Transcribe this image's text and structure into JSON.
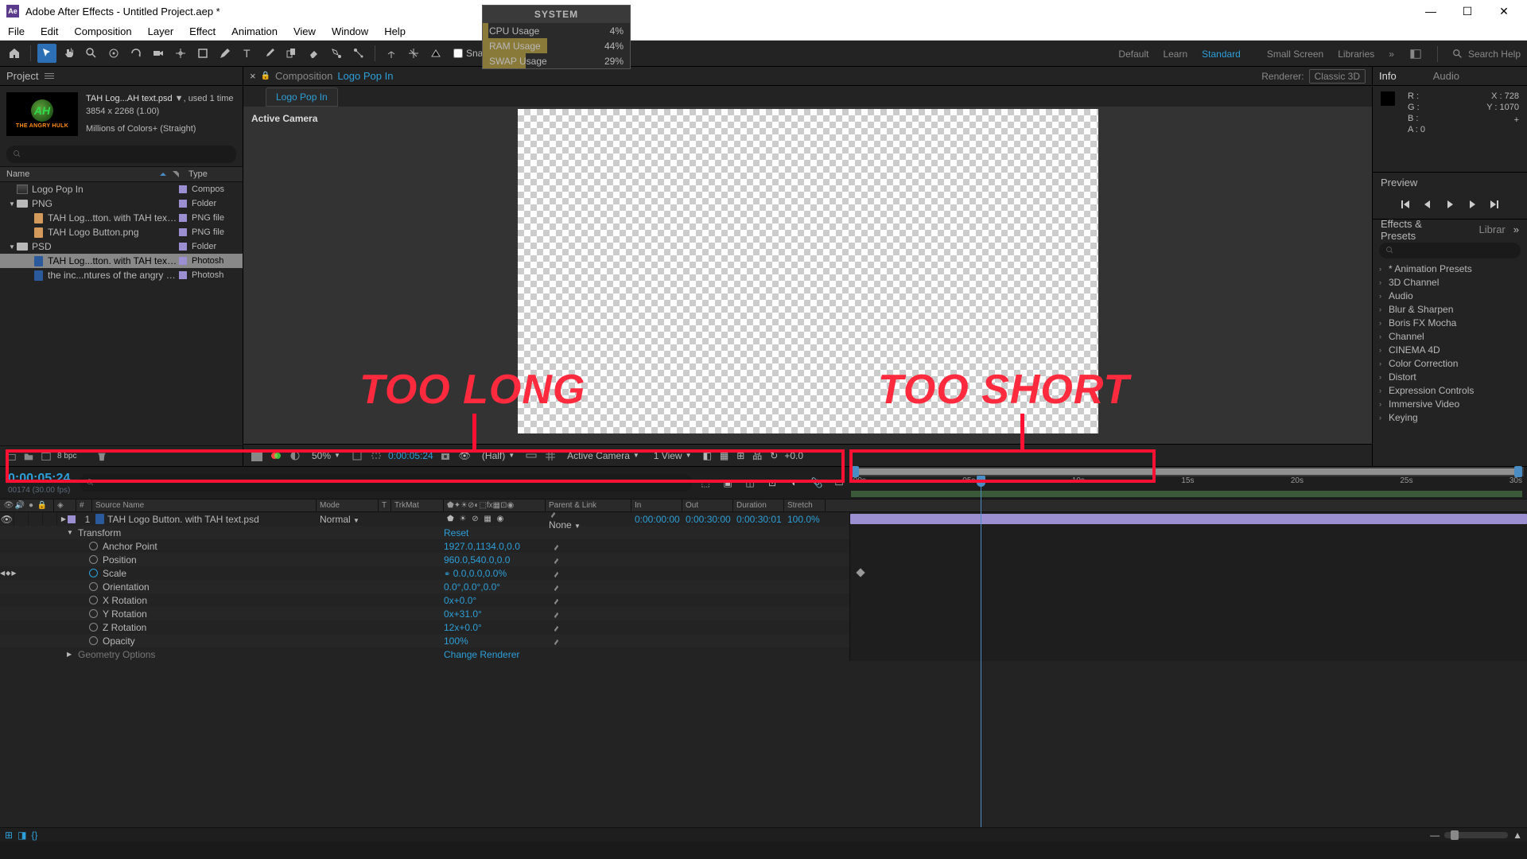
{
  "title": "Adobe After Effects - Untitled Project.aep *",
  "menus": [
    "File",
    "Edit",
    "Composition",
    "Layer",
    "Effect",
    "Animation",
    "View",
    "Window",
    "Help"
  ],
  "snapping": "Snapping",
  "workspaces": [
    "Default",
    "Learn",
    "Standard",
    "Small Screen",
    "Libraries"
  ],
  "workspace_active": "Standard",
  "search_help": "Search Help",
  "system": {
    "title": "SYSTEM",
    "rows": [
      {
        "label": "CPU Usage",
        "val": "4%",
        "pct": 4
      },
      {
        "label": "RAM Usage",
        "val": "44%",
        "pct": 44
      },
      {
        "label": "SWAP Usage",
        "val": "29%",
        "pct": 29
      }
    ]
  },
  "project": {
    "tab": "Project",
    "fname": "TAH Log...AH text.psd",
    "used": ", used 1 time",
    "dims": "3854 x 2268 (1.00)",
    "colors": "Millions of Colors+ (Straight)",
    "logo_sub": "THE ANGRY HULK",
    "hdrs": {
      "name": "Name",
      "type": "Type"
    },
    "bpc": "8 bpc",
    "tree": [
      {
        "ind": 10,
        "tw": "",
        "ico": "comp",
        "name": "Logo Pop In",
        "type": "Compos"
      },
      {
        "ind": 10,
        "tw": "▼",
        "ico": "folder",
        "name": "PNG",
        "type": "Folder"
      },
      {
        "ind": 30,
        "tw": "",
        "ico": "file",
        "name": "TAH Log...tton. with TAH text.png",
        "type": "PNG file"
      },
      {
        "ind": 30,
        "tw": "",
        "ico": "file",
        "name": "TAH Logo Button.png",
        "type": "PNG file"
      },
      {
        "ind": 10,
        "tw": "▼",
        "ico": "folder",
        "name": "PSD",
        "type": "Folder"
      },
      {
        "ind": 30,
        "tw": "",
        "ico": "psd",
        "name": "TAH Log...tton. with TAH text.psd",
        "type": "Photosh",
        "sel": true
      },
      {
        "ind": 30,
        "tw": "",
        "ico": "psd",
        "name": "the inc...ntures of the angry hulk.psd",
        "type": "Photosh"
      }
    ]
  },
  "comp": {
    "bc": "Composition",
    "name": "Logo Pop In",
    "tab": "Logo Pop In",
    "renderer_lbl": "Renderer:",
    "renderer": "Classic 3D",
    "active_cam": "Active Camera",
    "zoom": "50%",
    "time": "0:00:05:24",
    "res": "(Half)",
    "cam": "Active Camera",
    "views": "1 View",
    "exp": "+0.0"
  },
  "info": {
    "tab1": "Info",
    "tab2": "Audio",
    "R": "R :",
    "G": "G :",
    "B": "B :",
    "A": "A :  0",
    "X": "X : 728",
    "Y": "Y : 1070"
  },
  "preview": {
    "tab": "Preview"
  },
  "effects": {
    "tab1": "Effects & Presets",
    "tab2": "Librar",
    "list": [
      "* Animation Presets",
      "3D Channel",
      "Audio",
      "Blur & Sharpen",
      "Boris FX Mocha",
      "Channel",
      "CINEMA 4D",
      "Color Correction",
      "Distort",
      "Expression Controls",
      "Immersive Video",
      "Keying"
    ]
  },
  "timeline": {
    "time": "0:00:05:24",
    "sub": "00174 (30.00 fps)",
    "cols": {
      "av": "",
      "num": "#",
      "src": "Source Name",
      "mode": "Mode",
      "t": "T",
      "trk": "TrkMat",
      "sw": "",
      "parent": "Parent & Link",
      "in": "In",
      "out": "Out",
      "dur": "Duration",
      "str": "Stretch"
    },
    "ticks": [
      ":00s",
      "05s",
      "10s",
      "15s",
      "20s",
      "25s",
      "30s"
    ],
    "layer": {
      "num": "1",
      "name": "TAH Logo Button. with TAH text.psd",
      "mode": "Normal",
      "parent": "None",
      "in": "0:00:00:00",
      "out": "0:00:30:00",
      "dur": "0:00:30:01",
      "str": "100.0%"
    },
    "transform": "Transform",
    "reset": "Reset",
    "props": [
      {
        "n": "Anchor Point",
        "v": "1927.0,1134.0,0.0"
      },
      {
        "n": "Position",
        "v": "960.0,540.0,0.0"
      },
      {
        "n": "Scale",
        "v": "0.0,0.0,0.0%",
        "anim": true
      },
      {
        "n": "Orientation",
        "v": "0.0°,0.0°,0.0°"
      },
      {
        "n": "X Rotation",
        "v": "0x+0.0°"
      },
      {
        "n": "Y Rotation",
        "v": "0x+31.0°"
      },
      {
        "n": "Z Rotation",
        "v": "12x+0.0°"
      },
      {
        "n": "Opacity",
        "v": "100%"
      }
    ],
    "geom": "Geometry Options",
    "chrend": "Change Renderer"
  },
  "anno": {
    "long": "TOO LONG",
    "short": "TOO SHORT"
  }
}
